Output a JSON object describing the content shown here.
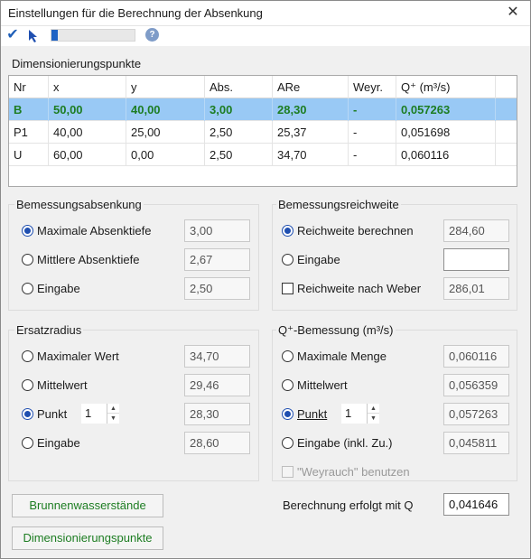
{
  "window": {
    "title": "Einstellungen für die Berechnung der Absenkung"
  },
  "toolbar": {
    "progress_percent": 8
  },
  "dim": {
    "label": "Dimensionierungspunkte",
    "columns": [
      "Nr",
      "x",
      "y",
      "Abs.",
      "ARe",
      "Weyr.",
      "Q⁺ (m³/s)"
    ],
    "rows": [
      [
        "B",
        "50,00",
        "40,00",
        "3,00",
        "28,30",
        "-",
        "0,057263"
      ],
      [
        "P1",
        "40,00",
        "25,00",
        "2,50",
        "25,37",
        "-",
        "0,051698"
      ],
      [
        "U",
        "60,00",
        "0,00",
        "2,50",
        "34,70",
        "-",
        "0,060116"
      ]
    ]
  },
  "absenkung": {
    "title": "Bemessungsabsenkung",
    "options": [
      {
        "label": "Maximale Absenktiefe",
        "value": "3,00"
      },
      {
        "label": "Mittlere Absenktiefe",
        "value": "2,67"
      },
      {
        "label": "Eingabe",
        "value": "2,50"
      }
    ]
  },
  "reichweite": {
    "title": "Bemessungsreichweite",
    "options": [
      {
        "label": "Reichweite berechnen",
        "value": "284,60"
      },
      {
        "label": "Eingabe",
        "value": ""
      },
      {
        "label": "Reichweite nach Weber",
        "value": "286,01"
      }
    ]
  },
  "ersatz": {
    "title": "Ersatzradius",
    "options": [
      {
        "label": "Maximaler Wert",
        "value": "34,70"
      },
      {
        "label": "Mittelwert",
        "value": "29,46"
      },
      {
        "label": "Punkt",
        "value": "28,30",
        "spin": "1"
      },
      {
        "label": "Eingabe",
        "value": "28,60"
      }
    ]
  },
  "qbem": {
    "title": "Q⁺-Bemessung (m³/s)",
    "options": [
      {
        "label": "Maximale Menge",
        "value": "0,060116"
      },
      {
        "label": "Mittelwert",
        "value": "0,056359"
      },
      {
        "label": "Punkt",
        "value": "0,057263",
        "spin": "1"
      },
      {
        "label": "Eingabe (inkl. Zu.)",
        "value": "0,045811"
      }
    ],
    "weyrauch": "\"Weyrauch\" benutzen"
  },
  "footer": {
    "btn_brunnen": "Brunnenwasserstände",
    "btn_dim": "Dimensionierungspunkte",
    "q_label": "Berechnung erfolgt mit Q",
    "q_value": "0,041646"
  }
}
